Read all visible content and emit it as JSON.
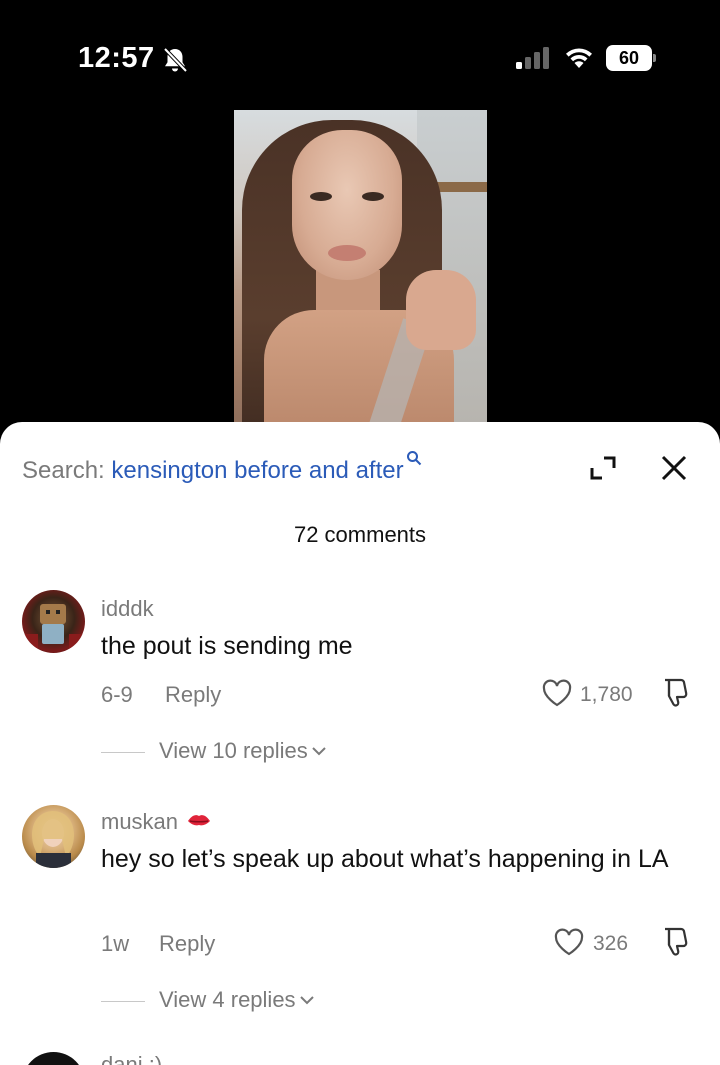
{
  "status_bar": {
    "time": "12:57",
    "battery": "60",
    "icons": [
      "bell-slash-icon",
      "signal-icon",
      "wifi-icon",
      "battery-icon"
    ]
  },
  "search": {
    "label": "Search: ",
    "query": "kensington before and after"
  },
  "comments_header": "72 comments",
  "comments": [
    {
      "username": "idddk",
      "text": "the pout is sending me",
      "date": "6-9",
      "reply_label": "Reply",
      "likes": "1,780",
      "view_replies": "View 10 replies"
    },
    {
      "username": "muskan",
      "text": "hey so let’s speak up about what’s happening in LA",
      "date": "1w",
      "reply_label": "Reply",
      "likes": "326",
      "view_replies": "View 4 replies"
    }
  ],
  "next_comment": {
    "username": "dani :)"
  },
  "colors": {
    "search_query": "#2b5bb8",
    "secondary_text": "#7a7a7a",
    "sheet_background": "#ffffff"
  }
}
